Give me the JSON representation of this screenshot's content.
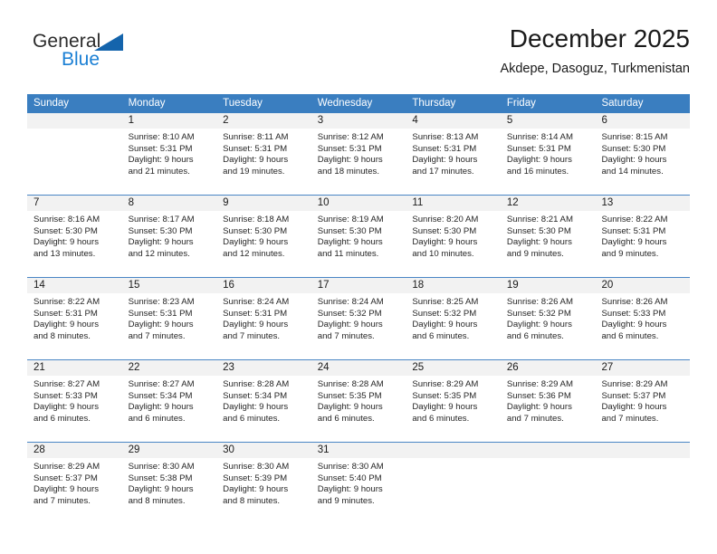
{
  "logo": {
    "word_one": "General",
    "word_two": "Blue",
    "triangle_color": "#1464ac",
    "blue_color": "#1a7fd4"
  },
  "header": {
    "title": "December 2025",
    "subtitle": "Akdepe, Dasoguz, Turkmenistan"
  },
  "theme": {
    "header_bar_color": "#3a7ec0",
    "week_separator_color": "#4a86c5",
    "daynum_background": "#f2f2f2"
  },
  "calendar": {
    "weekday_headers": [
      "Sunday",
      "Monday",
      "Tuesday",
      "Wednesday",
      "Thursday",
      "Friday",
      "Saturday"
    ],
    "weeks": [
      [
        {
          "day": "",
          "sunrise": "",
          "sunset": "",
          "daylight_line1": "",
          "daylight_line2": ""
        },
        {
          "day": "1",
          "sunrise": "Sunrise: 8:10 AM",
          "sunset": "Sunset: 5:31 PM",
          "daylight_line1": "Daylight: 9 hours",
          "daylight_line2": "and 21 minutes."
        },
        {
          "day": "2",
          "sunrise": "Sunrise: 8:11 AM",
          "sunset": "Sunset: 5:31 PM",
          "daylight_line1": "Daylight: 9 hours",
          "daylight_line2": "and 19 minutes."
        },
        {
          "day": "3",
          "sunrise": "Sunrise: 8:12 AM",
          "sunset": "Sunset: 5:31 PM",
          "daylight_line1": "Daylight: 9 hours",
          "daylight_line2": "and 18 minutes."
        },
        {
          "day": "4",
          "sunrise": "Sunrise: 8:13 AM",
          "sunset": "Sunset: 5:31 PM",
          "daylight_line1": "Daylight: 9 hours",
          "daylight_line2": "and 17 minutes."
        },
        {
          "day": "5",
          "sunrise": "Sunrise: 8:14 AM",
          "sunset": "Sunset: 5:31 PM",
          "daylight_line1": "Daylight: 9 hours",
          "daylight_line2": "and 16 minutes."
        },
        {
          "day": "6",
          "sunrise": "Sunrise: 8:15 AM",
          "sunset": "Sunset: 5:30 PM",
          "daylight_line1": "Daylight: 9 hours",
          "daylight_line2": "and 14 minutes."
        }
      ],
      [
        {
          "day": "7",
          "sunrise": "Sunrise: 8:16 AM",
          "sunset": "Sunset: 5:30 PM",
          "daylight_line1": "Daylight: 9 hours",
          "daylight_line2": "and 13 minutes."
        },
        {
          "day": "8",
          "sunrise": "Sunrise: 8:17 AM",
          "sunset": "Sunset: 5:30 PM",
          "daylight_line1": "Daylight: 9 hours",
          "daylight_line2": "and 12 minutes."
        },
        {
          "day": "9",
          "sunrise": "Sunrise: 8:18 AM",
          "sunset": "Sunset: 5:30 PM",
          "daylight_line1": "Daylight: 9 hours",
          "daylight_line2": "and 12 minutes."
        },
        {
          "day": "10",
          "sunrise": "Sunrise: 8:19 AM",
          "sunset": "Sunset: 5:30 PM",
          "daylight_line1": "Daylight: 9 hours",
          "daylight_line2": "and 11 minutes."
        },
        {
          "day": "11",
          "sunrise": "Sunrise: 8:20 AM",
          "sunset": "Sunset: 5:30 PM",
          "daylight_line1": "Daylight: 9 hours",
          "daylight_line2": "and 10 minutes."
        },
        {
          "day": "12",
          "sunrise": "Sunrise: 8:21 AM",
          "sunset": "Sunset: 5:30 PM",
          "daylight_line1": "Daylight: 9 hours",
          "daylight_line2": "and 9 minutes."
        },
        {
          "day": "13",
          "sunrise": "Sunrise: 8:22 AM",
          "sunset": "Sunset: 5:31 PM",
          "daylight_line1": "Daylight: 9 hours",
          "daylight_line2": "and 9 minutes."
        }
      ],
      [
        {
          "day": "14",
          "sunrise": "Sunrise: 8:22 AM",
          "sunset": "Sunset: 5:31 PM",
          "daylight_line1": "Daylight: 9 hours",
          "daylight_line2": "and 8 minutes."
        },
        {
          "day": "15",
          "sunrise": "Sunrise: 8:23 AM",
          "sunset": "Sunset: 5:31 PM",
          "daylight_line1": "Daylight: 9 hours",
          "daylight_line2": "and 7 minutes."
        },
        {
          "day": "16",
          "sunrise": "Sunrise: 8:24 AM",
          "sunset": "Sunset: 5:31 PM",
          "daylight_line1": "Daylight: 9 hours",
          "daylight_line2": "and 7 minutes."
        },
        {
          "day": "17",
          "sunrise": "Sunrise: 8:24 AM",
          "sunset": "Sunset: 5:32 PM",
          "daylight_line1": "Daylight: 9 hours",
          "daylight_line2": "and 7 minutes."
        },
        {
          "day": "18",
          "sunrise": "Sunrise: 8:25 AM",
          "sunset": "Sunset: 5:32 PM",
          "daylight_line1": "Daylight: 9 hours",
          "daylight_line2": "and 6 minutes."
        },
        {
          "day": "19",
          "sunrise": "Sunrise: 8:26 AM",
          "sunset": "Sunset: 5:32 PM",
          "daylight_line1": "Daylight: 9 hours",
          "daylight_line2": "and 6 minutes."
        },
        {
          "day": "20",
          "sunrise": "Sunrise: 8:26 AM",
          "sunset": "Sunset: 5:33 PM",
          "daylight_line1": "Daylight: 9 hours",
          "daylight_line2": "and 6 minutes."
        }
      ],
      [
        {
          "day": "21",
          "sunrise": "Sunrise: 8:27 AM",
          "sunset": "Sunset: 5:33 PM",
          "daylight_line1": "Daylight: 9 hours",
          "daylight_line2": "and 6 minutes."
        },
        {
          "day": "22",
          "sunrise": "Sunrise: 8:27 AM",
          "sunset": "Sunset: 5:34 PM",
          "daylight_line1": "Daylight: 9 hours",
          "daylight_line2": "and 6 minutes."
        },
        {
          "day": "23",
          "sunrise": "Sunrise: 8:28 AM",
          "sunset": "Sunset: 5:34 PM",
          "daylight_line1": "Daylight: 9 hours",
          "daylight_line2": "and 6 minutes."
        },
        {
          "day": "24",
          "sunrise": "Sunrise: 8:28 AM",
          "sunset": "Sunset: 5:35 PM",
          "daylight_line1": "Daylight: 9 hours",
          "daylight_line2": "and 6 minutes."
        },
        {
          "day": "25",
          "sunrise": "Sunrise: 8:29 AM",
          "sunset": "Sunset: 5:35 PM",
          "daylight_line1": "Daylight: 9 hours",
          "daylight_line2": "and 6 minutes."
        },
        {
          "day": "26",
          "sunrise": "Sunrise: 8:29 AM",
          "sunset": "Sunset: 5:36 PM",
          "daylight_line1": "Daylight: 9 hours",
          "daylight_line2": "and 7 minutes."
        },
        {
          "day": "27",
          "sunrise": "Sunrise: 8:29 AM",
          "sunset": "Sunset: 5:37 PM",
          "daylight_line1": "Daylight: 9 hours",
          "daylight_line2": "and 7 minutes."
        }
      ],
      [
        {
          "day": "28",
          "sunrise": "Sunrise: 8:29 AM",
          "sunset": "Sunset: 5:37 PM",
          "daylight_line1": "Daylight: 9 hours",
          "daylight_line2": "and 7 minutes."
        },
        {
          "day": "29",
          "sunrise": "Sunrise: 8:30 AM",
          "sunset": "Sunset: 5:38 PM",
          "daylight_line1": "Daylight: 9 hours",
          "daylight_line2": "and 8 minutes."
        },
        {
          "day": "30",
          "sunrise": "Sunrise: 8:30 AM",
          "sunset": "Sunset: 5:39 PM",
          "daylight_line1": "Daylight: 9 hours",
          "daylight_line2": "and 8 minutes."
        },
        {
          "day": "31",
          "sunrise": "Sunrise: 8:30 AM",
          "sunset": "Sunset: 5:40 PM",
          "daylight_line1": "Daylight: 9 hours",
          "daylight_line2": "and 9 minutes."
        },
        {
          "day": "",
          "sunrise": "",
          "sunset": "",
          "daylight_line1": "",
          "daylight_line2": ""
        },
        {
          "day": "",
          "sunrise": "",
          "sunset": "",
          "daylight_line1": "",
          "daylight_line2": ""
        },
        {
          "day": "",
          "sunrise": "",
          "sunset": "",
          "daylight_line1": "",
          "daylight_line2": ""
        }
      ]
    ]
  }
}
